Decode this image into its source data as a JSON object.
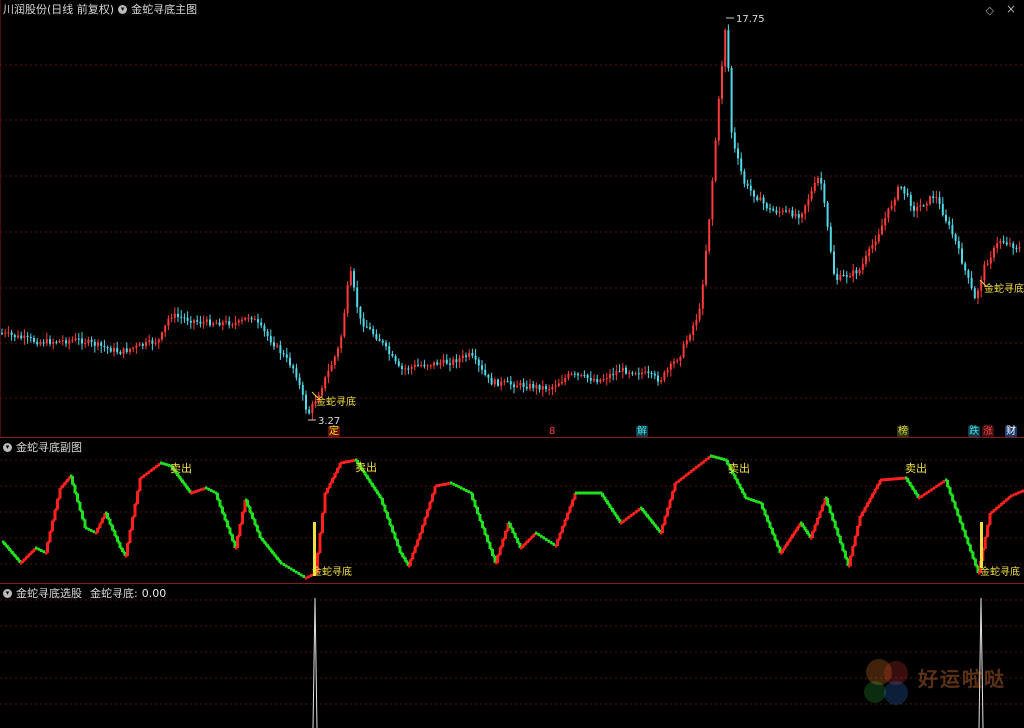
{
  "main": {
    "title": "川润股份(日线 前复权)",
    "indicator": "金蛇寻底主图",
    "high_label": "17.75",
    "low_label": "3.27",
    "signal_label": "金蛇寻底"
  },
  "events": [
    {
      "text": "定",
      "color": "#e8e800",
      "bg": "#6b1010"
    },
    {
      "text": "8",
      "color": "#ff4040",
      "bg": "transparent"
    },
    {
      "text": "解",
      "color": "#40e0e0",
      "bg": "#103a4a"
    },
    {
      "text": "榜",
      "color": "#e0d040",
      "bg": "#2a3a10"
    },
    {
      "text": "跌",
      "color": "#40e0e0",
      "bg": "#103a4a"
    },
    {
      "text": "涨",
      "color": "#ff4040",
      "bg": "#3a1010"
    },
    {
      "text": "财",
      "color": "#ffffff",
      "bg": "#1a3a6a"
    }
  ],
  "sub": {
    "title": "金蛇寻底副图",
    "sell_label": "卖出",
    "buy_label": "金蛇寻底"
  },
  "bottom": {
    "title": "金蛇寻底选股",
    "series_name": "金蛇寻底:",
    "value": "0.00"
  },
  "watermark": "好运啦哒",
  "colors": {
    "up": "#ff3b3b",
    "down": "#54d8e8",
    "grid": "#5a1010",
    "osc_up": "#ff2020",
    "osc_down": "#20e020",
    "signal": "#f0e040"
  }
}
